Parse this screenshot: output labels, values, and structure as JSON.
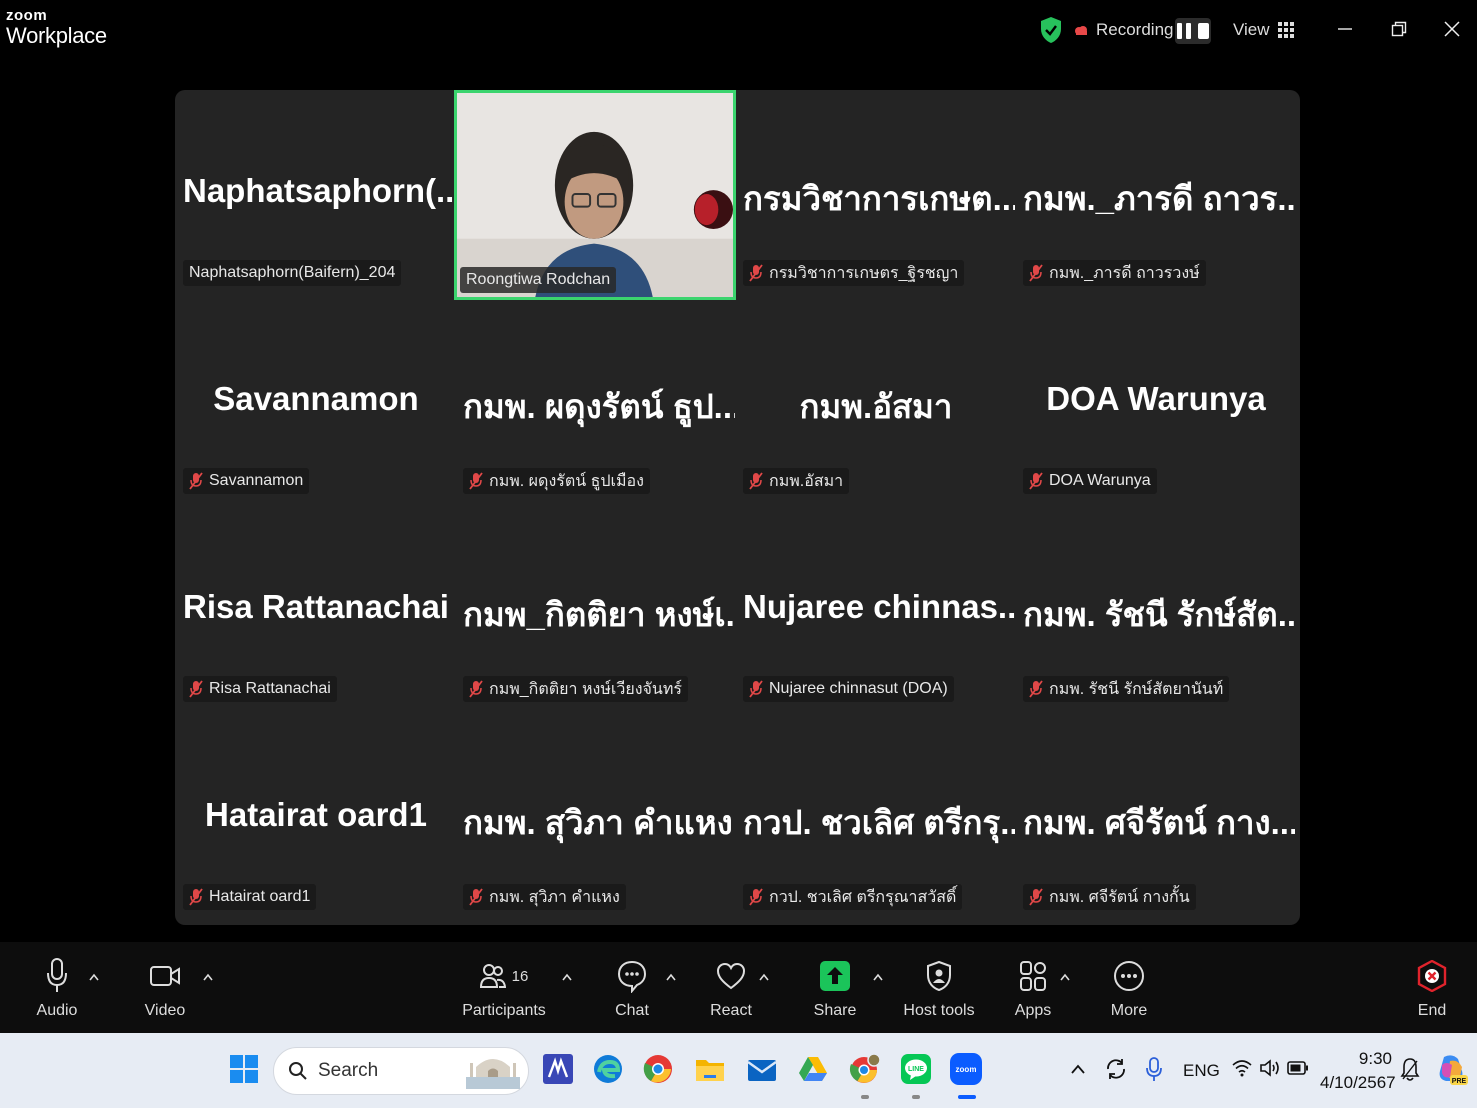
{
  "app": {
    "logo_small": "zoom",
    "logo_big": "Workplace",
    "recording_label": "Recording...",
    "view_label": "View"
  },
  "tiles": [
    {
      "big": "Naphatsaphorn(...",
      "label": "Naphatsaphorn(Baifern)_204",
      "muted": false
    },
    {
      "big": "",
      "label": "Roongtiwa Rodchan",
      "muted": false,
      "video": true
    },
    {
      "big": "กรมวิชาการเกษต...",
      "label": "กรมวิชาการเกษตร_ฐิรชญา",
      "muted": true
    },
    {
      "big": "กมพ._ภารดี ถาวร...",
      "label": "กมพ._ภารดี ถาวรวงษ์",
      "muted": true
    },
    {
      "big": "Savannamon",
      "label": "Savannamon",
      "muted": true
    },
    {
      "big": "กมพ. ผดุงรัตน์ ธูป...",
      "label": "กมพ. ผดุงรัตน์ ธูปเมือง",
      "muted": true
    },
    {
      "big": "กมพ.อัสมา",
      "label": "กมพ.อัสมา",
      "muted": true
    },
    {
      "big": "DOA Warunya",
      "label": "DOA Warunya",
      "muted": true
    },
    {
      "big": "Risa Rattanachai",
      "label": "Risa Rattanachai",
      "muted": true
    },
    {
      "big": "กมพ_กิตติยา หงษ์เ...",
      "label": "กมพ_กิตติยา หงษ์เวียงจันทร์",
      "muted": true
    },
    {
      "big": "Nujaree  chinnas...",
      "label": "Nujaree chinnasut (DOA)",
      "muted": true
    },
    {
      "big": "กมพ. รัชนี รักษ์สัต...",
      "label": "กมพ. รัชนี รักษ์สัตยานันท์",
      "muted": true
    },
    {
      "big": "Hatairat oard1",
      "label": "Hatairat oard1",
      "muted": true
    },
    {
      "big": "กมพ. สุวิภา คำแหง",
      "label": "กมพ. สุวิภา คำแหง",
      "muted": true
    },
    {
      "big": "กวป. ชวเลิศ ตรีกรุ...",
      "label": "กวป. ชวเลิศ ตรีกรุณาสวัสดิ์",
      "muted": true
    },
    {
      "big": "กมพ. ศจีรัตน์ กาง...",
      "label": "กมพ. ศจีรัตน์ กางกั้น",
      "muted": true
    }
  ],
  "toolbar": {
    "audio": "Audio",
    "video": "Video",
    "participants": "Participants",
    "participants_count": "16",
    "chat": "Chat",
    "react": "React",
    "share": "Share",
    "host_tools": "Host tools",
    "apps": "Apps",
    "more": "More",
    "end": "End"
  },
  "taskbar": {
    "search_placeholder": "Search",
    "lang": "ENG",
    "time": "9:30",
    "date": "4/10/2567"
  },
  "colors": {
    "active_speaker": "#3bd46e",
    "share_green": "#1bc45a",
    "end_red": "#e0232c",
    "muted_red": "#e04848"
  }
}
